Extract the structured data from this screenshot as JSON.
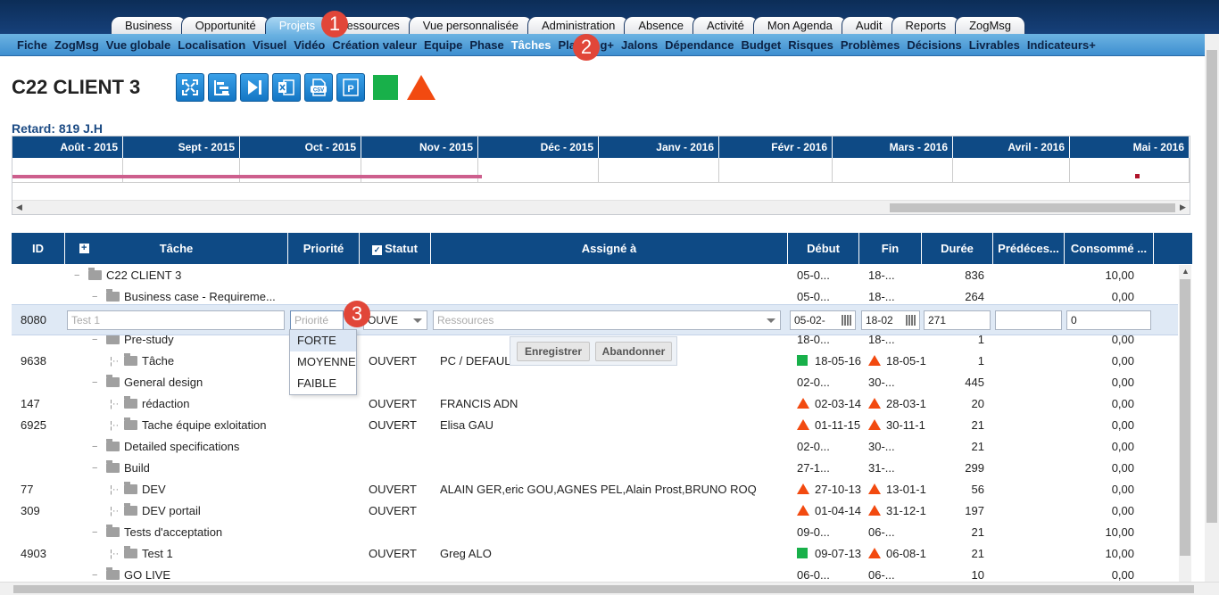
{
  "top_tabs": [
    "Business",
    "Opportunité",
    "Projets",
    "Ressources",
    "Vue personnalisée",
    "Administration",
    "Absence",
    "Activité",
    "Mon Agenda",
    "Audit",
    "Reports",
    "ZogMsg"
  ],
  "sub_nav": [
    "Fiche",
    "ZogMsg",
    "Vue globale",
    "Localisation",
    "Visuel",
    "Vidéo",
    "Création valeur",
    "Equipe",
    "Phase",
    "Tâches",
    "Planning+",
    "Jalons",
    "Dépendance",
    "Budget",
    "Risques",
    "Problèmes",
    "Décisions",
    "Livrables",
    "Indicateurs+"
  ],
  "badges": [
    "1",
    "2",
    "3"
  ],
  "project": {
    "title": "C22 CLIENT 3",
    "retard": "Retard: 819 J.H"
  },
  "toolbar_icons": [
    "fullscreen-icon",
    "gantt-icon",
    "skip-end-icon",
    "excel-icon",
    "csv-icon",
    "ms-project-icon"
  ],
  "gantt": {
    "months": [
      "Août - 2015",
      "Sept - 2015",
      "Oct - 2015",
      "Nov - 2015",
      "Déc - 2015",
      "Janv - 2016",
      "Févr - 2016",
      "Mars - 2016",
      "Avril - 2016",
      "Mai - 2016"
    ],
    "bar_color": "#cd5f8d"
  },
  "grid": {
    "columns": [
      "ID",
      "Tâche",
      "Priorité",
      "Statut",
      "Assigné à",
      "Début",
      "Fin",
      "Durée",
      "Prédéces...",
      "Consommé ..."
    ],
    "rows": [
      {
        "id": "",
        "task": "C22 CLIENT 3",
        "level": 0,
        "priority": "",
        "status": "",
        "assigned": "",
        "start": "05-0...",
        "end": "18-...",
        "duration": "836",
        "consumed": "10,00"
      },
      {
        "id": "",
        "task": "Business case - Requireme...",
        "level": 1,
        "priority": "",
        "status": "",
        "assigned": "",
        "start": "05-0...",
        "end": "18-...",
        "duration": "264",
        "consumed": "0,00"
      },
      {
        "id": "",
        "task": "",
        "level": 0,
        "priority": "",
        "status": "",
        "assigned": "",
        "start": "",
        "end": "",
        "duration": "",
        "consumed": ""
      },
      {
        "id": "",
        "task": "Pre-study",
        "level": 1,
        "priority": "",
        "status": "",
        "assigned": "",
        "start": "18-0...",
        "end": "18-...",
        "duration": "1",
        "consumed": "0,00"
      },
      {
        "id": "9638",
        "task": "Tâche",
        "level": 2,
        "priority": "",
        "status": "OUVERT",
        "assigned": "PC / DEFAULT",
        "start_flag": "green",
        "start": "18-05-16",
        "end_flag": "red",
        "end": "18-05-1",
        "duration": "1",
        "consumed": "0,00"
      },
      {
        "id": "",
        "task": "General design",
        "level": 1,
        "priority": "",
        "status": "",
        "assigned": "",
        "start": "02-0...",
        "end": "30-...",
        "duration": "445",
        "consumed": "0,00"
      },
      {
        "id": "147",
        "task": "rédaction",
        "level": 2,
        "priority": "",
        "status": "OUVERT",
        "assigned": "FRANCIS ADN",
        "start_flag": "red",
        "start": "02-03-14",
        "end_flag": "red",
        "end": "28-03-1",
        "duration": "20",
        "consumed": "0,00"
      },
      {
        "id": "6925",
        "task": "Tache équipe exloitation",
        "level": 2,
        "priority": "",
        "status": "OUVERT",
        "assigned": "Elisa GAU",
        "start_flag": "red",
        "start": "01-11-15",
        "end_flag": "red",
        "end": "30-11-1",
        "duration": "21",
        "consumed": "0,00"
      },
      {
        "id": "",
        "task": "Detailed specifications",
        "level": 1,
        "priority": "",
        "status": "",
        "assigned": "",
        "start": "02-0...",
        "end": "30-...",
        "duration": "21",
        "consumed": "0,00"
      },
      {
        "id": "",
        "task": "Build",
        "level": 1,
        "priority": "",
        "status": "",
        "assigned": "",
        "start": "27-1...",
        "end": "31-...",
        "duration": "299",
        "consumed": "0,00"
      },
      {
        "id": "77",
        "task": "DEV",
        "level": 2,
        "priority": "",
        "status": "OUVERT",
        "assigned": "ALAIN GER,eric GOU,AGNES PEL,Alain Prost,BRUNO ROQ",
        "start_flag": "red",
        "start": "27-10-13",
        "end_flag": "red",
        "end": "13-01-1",
        "duration": "56",
        "consumed": "0,00"
      },
      {
        "id": "309",
        "task": "DEV portail",
        "level": 2,
        "priority": "",
        "status": "OUVERT",
        "assigned": "",
        "start_flag": "red",
        "start": "01-04-14",
        "end_flag": "red",
        "end": "31-12-1",
        "duration": "197",
        "consumed": "0,00"
      },
      {
        "id": "",
        "task": "Tests d'acceptation",
        "level": 1,
        "priority": "",
        "status": "",
        "assigned": "",
        "start": "09-0...",
        "end": "06-...",
        "duration": "21",
        "consumed": "10,00"
      },
      {
        "id": "4903",
        "task": "Test 1",
        "level": 2,
        "priority": "",
        "status": "OUVERT",
        "assigned": "Greg ALO",
        "start_flag": "green",
        "start": "09-07-13",
        "end_flag": "red",
        "end": "06-08-1",
        "duration": "21",
        "consumed": "10,00"
      },
      {
        "id": "",
        "task": "GO LIVE",
        "level": 1,
        "priority": "",
        "status": "",
        "assigned": "",
        "start": "06-0...",
        "end": "06-...",
        "duration": "10",
        "consumed": "0,00"
      }
    ]
  },
  "edit_row": {
    "id": "8080",
    "task_placeholder": "Test 1",
    "priority_placeholder": "Priorité",
    "status_value": "OUVE",
    "resources_placeholder": "Ressources",
    "start": "05-02-",
    "end": "18-02",
    "duration": "271",
    "predecessor": "",
    "consumed": "0"
  },
  "priority_options": [
    "FORTE",
    "MOYENNE",
    "FAIBLE"
  ],
  "actions": {
    "save": "Enregistrer",
    "cancel": "Abandonner"
  }
}
